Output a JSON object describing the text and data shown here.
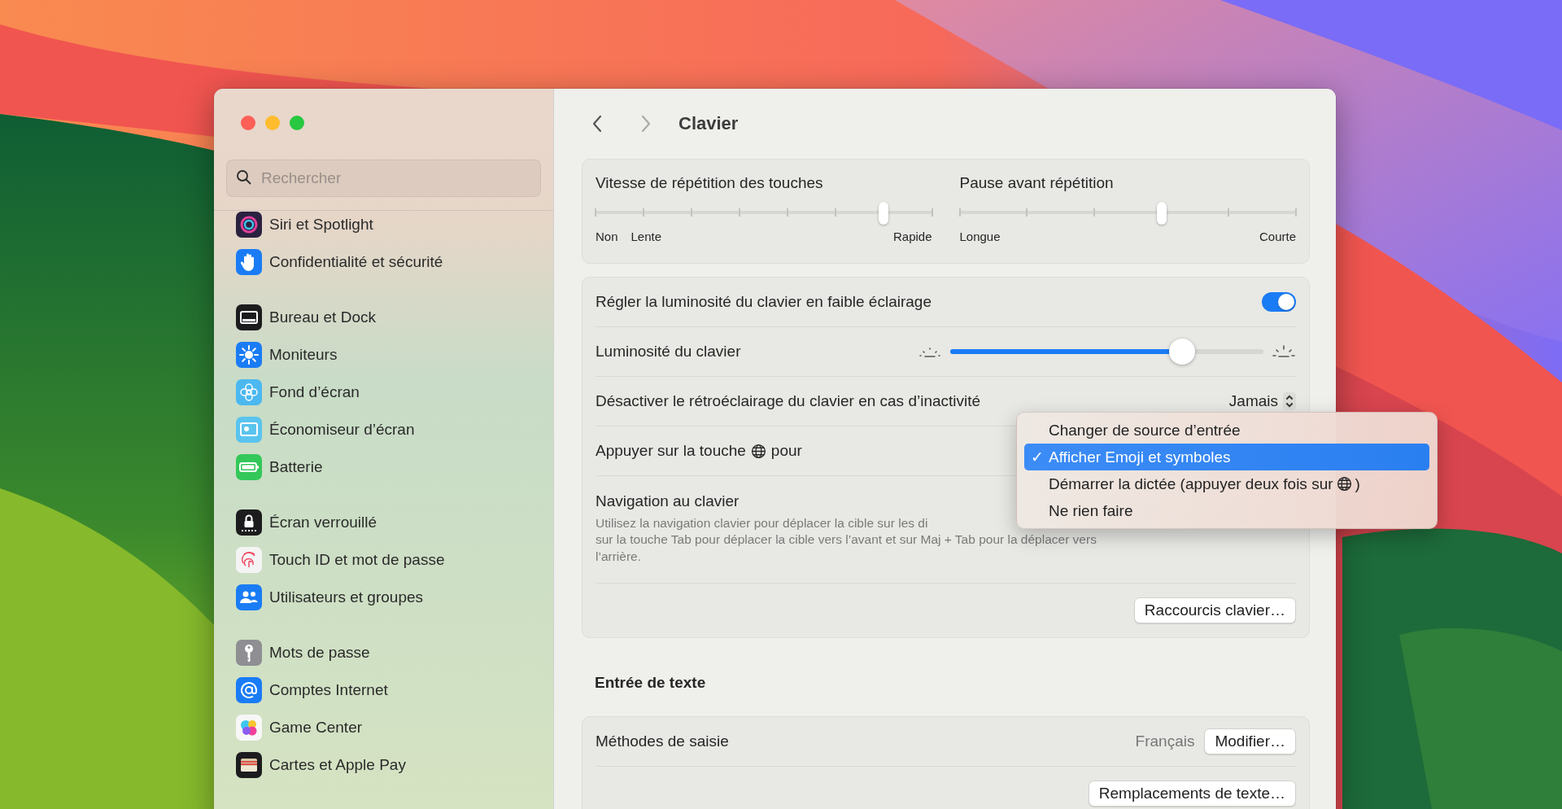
{
  "window": {
    "title": "Clavier"
  },
  "sidebar": {
    "search": {
      "placeholder": "Rechercher"
    },
    "groups": [
      [
        {
          "label": "Siri et Spotlight",
          "kind": "siri",
          "color": "#2b2140"
        },
        {
          "label": "Confidentialité et sécurité",
          "kind": "hand",
          "color": "#1a7cf5"
        }
      ],
      [
        {
          "label": "Bureau et Dock",
          "kind": "dock",
          "color": "#1c1c1e"
        },
        {
          "label": "Moniteurs",
          "kind": "sun",
          "color": "#1a7cf5"
        },
        {
          "label": "Fond d’écran",
          "kind": "flower",
          "color": "#4cb8f0"
        },
        {
          "label": "Économiseur d’écran",
          "kind": "screen",
          "color": "#5ac4ee"
        },
        {
          "label": "Batterie",
          "kind": "battery",
          "color": "#34c759"
        }
      ],
      [
        {
          "label": "Écran verrouillé",
          "kind": "lock",
          "color": "#1c1c1e"
        },
        {
          "label": "Touch ID et mot de passe",
          "kind": "fingerprint",
          "color": "#f4f4f4"
        },
        {
          "label": "Utilisateurs et groupes",
          "kind": "people",
          "color": "#1a7cf5"
        }
      ],
      [
        {
          "label": "Mots de passe",
          "kind": "key",
          "color": "#8e8e93"
        },
        {
          "label": "Comptes Internet",
          "kind": "at",
          "color": "#1a7cf5"
        },
        {
          "label": "Game Center",
          "kind": "game",
          "color": "#f7f7f7"
        },
        {
          "label": "Cartes et Apple Pay",
          "kind": "wallet",
          "color": "#1c1c1e"
        }
      ]
    ]
  },
  "repeat": [
    {
      "kind": "speed",
      "title": "Vitesse de répétition des touches",
      "level": 0.857,
      "labels_start": [
        "Non",
        "Lente"
      ],
      "label_end": "Rapide"
    },
    {
      "kind": "delay",
      "title": "Pause avant répétition",
      "level": 0.6,
      "labels_start": [
        "Longue"
      ],
      "label_end": "Courte"
    }
  ],
  "rows": [
    {
      "kind": "toggle",
      "label": "Régler la luminosité du clavier en faible éclairage",
      "on": true
    },
    {
      "kind": "slider",
      "label": "Luminosité du clavier",
      "level": 0.74
    },
    {
      "kind": "popup",
      "label": "Désactiver le rétroéclairage du clavier en cas d’inactivité",
      "value": "Jamais"
    },
    {
      "kind": "globe",
      "label": "Appuyer sur la touche",
      "suffix": "pour"
    },
    {
      "kind": "text",
      "label": "Navigation au clavier",
      "description_lines": [
        "Utilisez la navigation clavier pour déplacer la cible sur les di",
        "sur la touche Tab pour déplacer la cible vers l’avant et sur Maj + Tab pour la déplacer vers",
        "l’arrière."
      ]
    },
    {
      "kind": "button",
      "button": "Raccourcis clavier…"
    }
  ],
  "menu": {
    "items": [
      {
        "kind": "plain",
        "text": "Changer de source d’entrée",
        "selected": false
      },
      {
        "kind": "plain",
        "text": "Afficher Emoji et symboles",
        "selected": true
      },
      {
        "kind": "globe",
        "text": "Démarrer la dictée (appuyer deux fois sur",
        "suffix": ")",
        "selected": false
      },
      {
        "kind": "plain",
        "text": "Ne rien faire",
        "selected": false
      }
    ],
    "check": "✓"
  },
  "text_input": {
    "heading": "Entrée de texte",
    "rows": [
      {
        "kind": "value-button",
        "label": "Méthodes de saisie",
        "value": "Français",
        "button": "Modifier…"
      },
      {
        "kind": "button",
        "button": "Remplacements de texte…"
      }
    ]
  }
}
